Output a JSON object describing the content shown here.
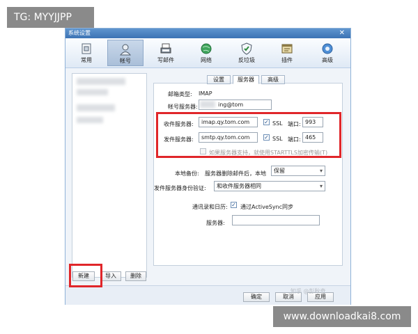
{
  "watermarks": {
    "top_left": "TG: MYYJJPP",
    "bottom_right": "www.downloadkai8.com",
    "zhihu": "知乎 @彭秋奇"
  },
  "window": {
    "title": "系统设置"
  },
  "toolbar": {
    "items": [
      {
        "label": "常用",
        "icon": "general-icon"
      },
      {
        "label": "帐号",
        "icon": "account-icon"
      },
      {
        "label": "写邮件",
        "icon": "compose-icon"
      },
      {
        "label": "网络",
        "icon": "network-icon"
      },
      {
        "label": "反垃圾",
        "icon": "antispam-shield-icon"
      },
      {
        "label": "插件",
        "icon": "plugin-icon"
      },
      {
        "label": "高级",
        "icon": "advanced-gear-icon"
      }
    ],
    "active": "帐号"
  },
  "subtabs": {
    "items": [
      "设置",
      "服务器",
      "高级"
    ],
    "active": "服务器"
  },
  "server": {
    "mailbox_type_label": "邮箱类型:",
    "mailbox_type_value": "IMAP",
    "account_server_label": "帐号服务器:",
    "account_server_value": "ing@tom",
    "incoming_label": "收件服务器:",
    "incoming_value": "imap.qy.tom.com",
    "incoming_ssl": "SSL",
    "incoming_port_label": "端口:",
    "incoming_port": "993",
    "outgoing_label": "发件服务器:",
    "outgoing_value": "smtp.qy.tom.com",
    "outgoing_ssl": "SSL",
    "outgoing_port_label": "端口:",
    "outgoing_port": "465",
    "starttls_note": "如果服务器支持，就使用STARTTLS加密传输(T)",
    "local_backup_label": "本地备份:",
    "local_backup_text": "服务器删除邮件后，本地",
    "local_backup_value": "保留",
    "smtp_auth_label": "发件服务器身份验证:",
    "smtp_auth_value": "和收件服务器相同",
    "contacts_label": "通讯录和日历:",
    "activesync_label": "通过ActiveSync同步",
    "server_label": "服务器:",
    "server_value": ""
  },
  "account_actions": {
    "new": "新建",
    "import": "导入",
    "delete": "删除"
  },
  "footer": {
    "ok": "确定",
    "cancel": "取消",
    "apply": "应用"
  }
}
